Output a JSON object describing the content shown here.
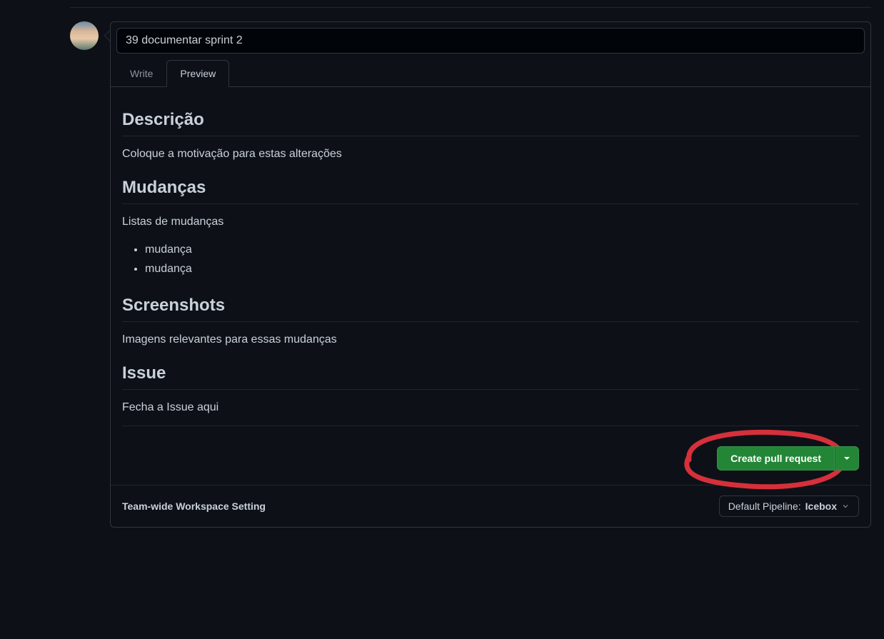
{
  "pr": {
    "title": "39 documentar sprint 2"
  },
  "tabs": {
    "write": "Write",
    "preview": "Preview"
  },
  "preview": {
    "sections": {
      "description": {
        "heading": "Descrição",
        "text": "Coloque a motivação para estas alterações"
      },
      "changes": {
        "heading": "Mudanças",
        "text": "Listas de mudanças",
        "items": [
          "mudança",
          "mudança"
        ]
      },
      "screenshots": {
        "heading": "Screenshots",
        "text": "Imagens relevantes para essas mudanças"
      },
      "issue": {
        "heading": "Issue",
        "text": "Fecha a Issue aqui"
      }
    }
  },
  "actions": {
    "create_pr": "Create pull request"
  },
  "footer": {
    "workspace_label": "Team-wide Workspace Setting",
    "pipeline_prefix": "Default Pipeline: ",
    "pipeline_value": "Icebox"
  },
  "colors": {
    "accent_green": "#238636",
    "annotation_red": "#d6303b"
  }
}
